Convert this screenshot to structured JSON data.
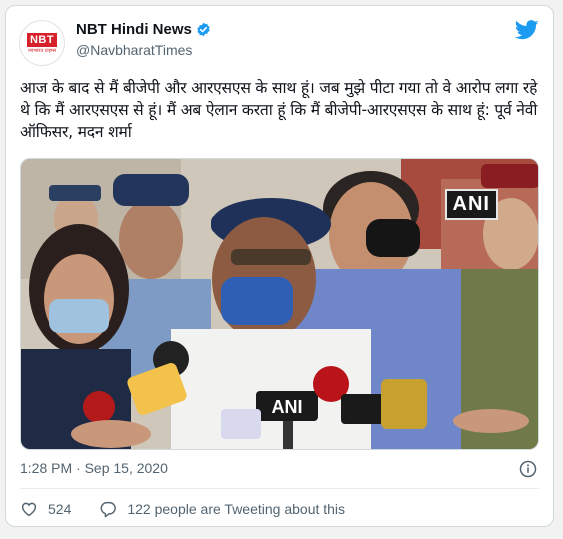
{
  "account": {
    "name": "NBT Hindi News",
    "handle": "@NavbharatTimes",
    "logo_text": "NBT",
    "logo_sub": "नवभारत टाइम्स"
  },
  "tweet": {
    "text": "आज के बाद से मैं बीजेपी और आरएसएस के साथ हूं। जब मुझे पीटा गया तो वे आरोप लगा रहे थे कि मैं आरएसएस से हूं। मैं अब ऐलान करता हूं कि मैं बीजेपी-आरएसएस के साथ हूं: पूर्व नेवी ऑफिसर, मदन शर्मा",
    "timestamp": "1:28 PM · Sep 15, 2020"
  },
  "media": {
    "watermark": "ANI",
    "mic_labels": [
      "ANI"
    ]
  },
  "engagement": {
    "likes": "524",
    "replies_text": "122 people are Tweeting about this"
  },
  "icons": {
    "verified": "verified-badge-icon",
    "twitter": "twitter-bird-icon",
    "info": "info-icon",
    "like": "heart-icon",
    "reply": "speech-bubble-icon"
  },
  "colors": {
    "twitter_blue": "#1d9bf0",
    "logo_red": "#d7202a",
    "muted_text": "#536471"
  }
}
